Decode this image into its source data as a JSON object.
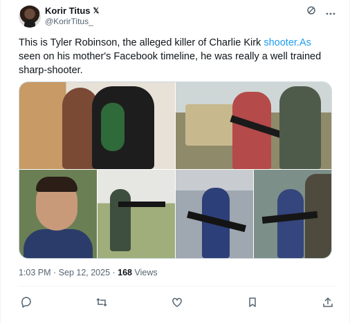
{
  "author": {
    "name": "Korir Titus",
    "verified_mark": "𝕏",
    "handle": "@KorirTitus_"
  },
  "header_icons": [
    "grok-icon",
    "more-icon"
  ],
  "tweet": {
    "text_before_link": "This is Tyler Robinson, the alleged killer of Charlie Kirk ",
    "link": "shooter.As",
    "text_after_link": " seen on his mother's Facebook timeline, he was really a well trained sharp-shooter."
  },
  "media": {
    "images": [
      {
        "name": "photo-graduation"
      },
      {
        "name": "photo-range-adult"
      },
      {
        "name": "photo-portrait"
      },
      {
        "name": "photo-shooting-yard"
      },
      {
        "name": "photo-kid-rifle-1"
      },
      {
        "name": "photo-kid-rifle-2"
      }
    ]
  },
  "meta": {
    "timestamp": "1:03 PM · Sep 12, 2025 · ",
    "views_count": "168",
    "views_label": " Views"
  },
  "actions": {
    "reply": "reply-icon",
    "repost": "repost-icon",
    "like": "like-icon",
    "bookmark": "bookmark-icon",
    "share": "share-icon"
  }
}
